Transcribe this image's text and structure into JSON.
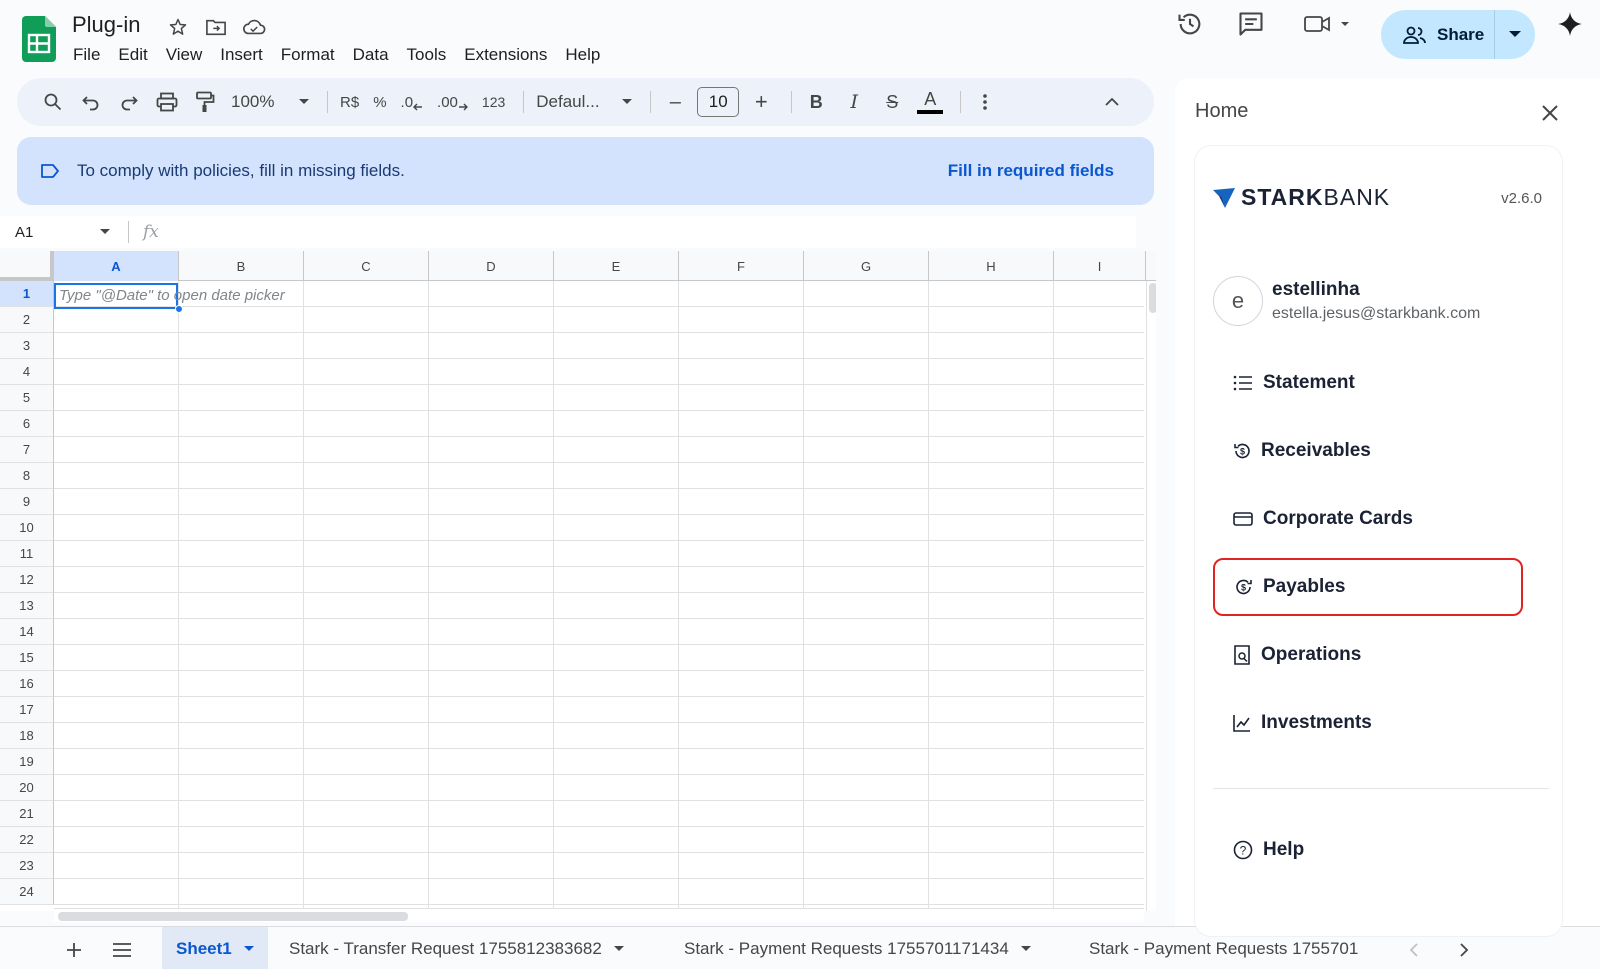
{
  "app": {
    "doc_title": "Plug-in",
    "menu": [
      "File",
      "Edit",
      "View",
      "Insert",
      "Format",
      "Data",
      "Tools",
      "Extensions",
      "Help"
    ],
    "share_label": "Share"
  },
  "toolbar": {
    "zoom": "100%",
    "currency": "R$",
    "percent": "%",
    "dec_decrease": ".0",
    "dec_increase": ".00",
    "number_format": "123",
    "font": "Defaul...",
    "font_size": "10",
    "minus": "–",
    "plus": "+",
    "bold": "B",
    "italic": "I",
    "strike": "S",
    "text_color": "A"
  },
  "banner": {
    "message": "To comply with policies, fill in missing fields.",
    "action": "Fill in required fields"
  },
  "formula_bar": {
    "cell_ref": "A1",
    "fx": "fx"
  },
  "grid": {
    "columns": [
      "A",
      "B",
      "C",
      "D",
      "E",
      "F",
      "G",
      "H",
      "I"
    ],
    "rows": [
      "1",
      "2",
      "3",
      "4",
      "5",
      "6",
      "7",
      "8",
      "9",
      "10",
      "11",
      "12",
      "13",
      "14",
      "15",
      "16",
      "17",
      "18",
      "19",
      "20",
      "21",
      "22",
      "23",
      "24"
    ],
    "selected_cell": "A1",
    "a1_placeholder": "Type \"@Date\" to open date picker"
  },
  "sheet_tabs": [
    {
      "label": "Sheet1",
      "active": true
    },
    {
      "label": "Stark - Transfer Request 1755812383682",
      "active": false
    },
    {
      "label": "Stark - Payment Requests 1755701171434",
      "active": false
    },
    {
      "label": "Stark - Payment Requests 1755701",
      "active": false
    }
  ],
  "panel": {
    "title": "Home",
    "brand_stark": "STARK",
    "brand_bank": "BANK",
    "version": "v2.6.0",
    "user": {
      "initial": "e",
      "name": "estellinha",
      "email": "estella.jesus@starkbank.com"
    },
    "nav": [
      {
        "label": "Statement",
        "icon": "list-icon"
      },
      {
        "label": "Receivables",
        "icon": "receivables-icon"
      },
      {
        "label": "Corporate Cards",
        "icon": "card-icon"
      },
      {
        "label": "Payables",
        "icon": "payables-icon",
        "highlighted": true
      },
      {
        "label": "Operations",
        "icon": "operations-icon"
      },
      {
        "label": "Investments",
        "icon": "investments-icon"
      }
    ],
    "help_label": "Help"
  },
  "colors": {
    "accent": "#0b57d0",
    "share_bg": "#c2e7ff",
    "banner_bg": "#d3e3fd",
    "highlight": "#e02424",
    "sheets_green": "#0f9d58"
  }
}
